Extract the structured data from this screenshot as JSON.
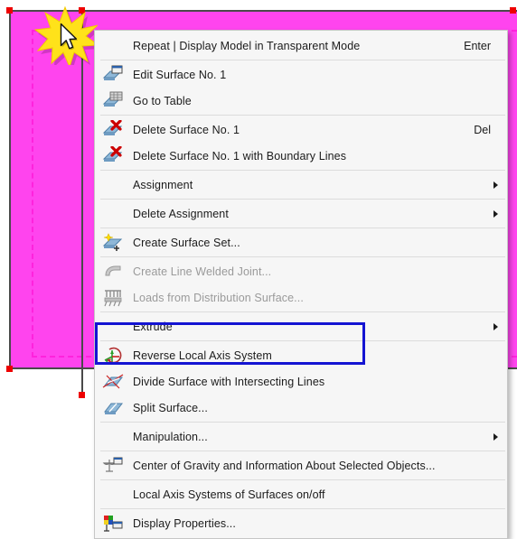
{
  "application": {
    "view": "3d-model-workspace",
    "selected_object": "Surface No. 1"
  },
  "canvas": {
    "surface_color": "#FF44EE",
    "edge_color": "#4A4A4A",
    "node_color": "#EE0000",
    "dashed_boundary_color": "#FF22DD",
    "click_marker": "starburst-selection-flash",
    "cursor": "arrow-pointer"
  },
  "context_menu": {
    "items": [
      {
        "id": "repeat",
        "icon": "",
        "label": "Repeat | Display Model in Transparent Mode",
        "accel": "Enter",
        "submenu": false,
        "disabled": false,
        "sep_after": true
      },
      {
        "id": "edit-surface",
        "icon": "surface-edit-icon",
        "label": "Edit Surface No. 1",
        "accel": "",
        "submenu": false,
        "disabled": false,
        "sep_after": false
      },
      {
        "id": "go-to-table",
        "icon": "surface-table-icon",
        "label": "Go to Table",
        "accel": "",
        "submenu": false,
        "disabled": false,
        "sep_after": true
      },
      {
        "id": "delete-surface",
        "icon": "surface-delete-icon",
        "label": "Delete Surface No. 1",
        "accel": "Del",
        "submenu": false,
        "disabled": false,
        "sep_after": false
      },
      {
        "id": "delete-surface-lines",
        "icon": "surface-delete-icon",
        "label": "Delete Surface No. 1 with Boundary Lines",
        "accel": "",
        "submenu": false,
        "disabled": false,
        "sep_after": true
      },
      {
        "id": "assignment",
        "icon": "",
        "label": "Assignment",
        "accel": "",
        "submenu": true,
        "disabled": false,
        "sep_after": true
      },
      {
        "id": "delete-assignment",
        "icon": "",
        "label": "Delete Assignment",
        "accel": "",
        "submenu": true,
        "disabled": false,
        "sep_after": true
      },
      {
        "id": "create-surface-set",
        "icon": "surface-set-add-icon",
        "label": "Create Surface Set...",
        "accel": "",
        "submenu": false,
        "disabled": false,
        "sep_after": true
      },
      {
        "id": "create-line-welded",
        "icon": "welded-joint-icon",
        "label": "Create Line Welded Joint...",
        "accel": "",
        "submenu": false,
        "disabled": true,
        "sep_after": false
      },
      {
        "id": "loads-distribution",
        "icon": "load-distribution-icon",
        "label": "Loads from Distribution Surface...",
        "accel": "",
        "submenu": false,
        "disabled": true,
        "sep_after": true
      },
      {
        "id": "extrude",
        "icon": "",
        "label": "Extrude",
        "accel": "",
        "submenu": true,
        "disabled": false,
        "sep_after": true
      },
      {
        "id": "reverse-local-axis",
        "icon": "axis-reverse-icon",
        "label": "Reverse Local Axis System",
        "accel": "",
        "submenu": false,
        "disabled": false,
        "sep_after": false
      },
      {
        "id": "divide-surface",
        "icon": "surface-divide-icon",
        "label": "Divide Surface with Intersecting Lines",
        "accel": "",
        "submenu": false,
        "disabled": false,
        "sep_after": false
      },
      {
        "id": "split-surface",
        "icon": "surface-split-icon",
        "label": "Split Surface...",
        "accel": "",
        "submenu": false,
        "disabled": false,
        "sep_after": true
      },
      {
        "id": "manipulation",
        "icon": "",
        "label": "Manipulation...",
        "accel": "",
        "submenu": true,
        "disabled": false,
        "sep_after": true
      },
      {
        "id": "center-of-gravity",
        "icon": "balance-scale-icon",
        "label": "Center of Gravity and Information About Selected Objects...",
        "accel": "",
        "submenu": false,
        "disabled": false,
        "sep_after": true
      },
      {
        "id": "local-axis-systems",
        "icon": "",
        "label": "Local Axis Systems of Surfaces on/off",
        "accel": "",
        "submenu": false,
        "disabled": false,
        "sep_after": true
      },
      {
        "id": "display-properties",
        "icon": "display-properties-icon",
        "label": "Display Properties...",
        "accel": "",
        "submenu": false,
        "disabled": false,
        "sep_after": false
      }
    ]
  },
  "annotation": {
    "highlight_color": "#1414D2",
    "highlighted_item_ids": [
      "divide-surface",
      "split-surface"
    ]
  }
}
